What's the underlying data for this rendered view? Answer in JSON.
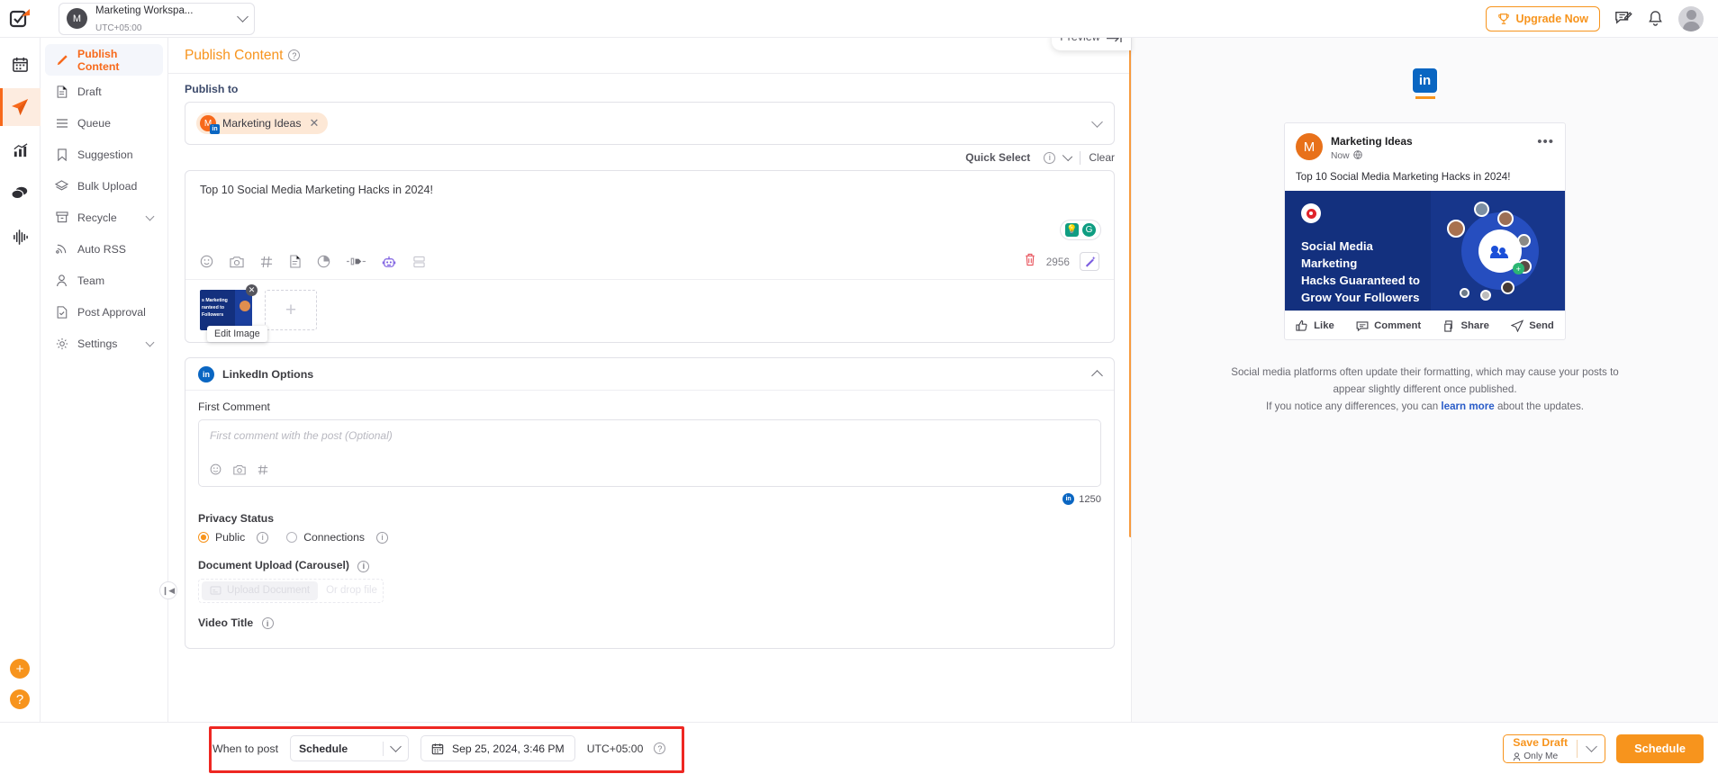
{
  "topbar": {
    "workspace_name": "Marketing Workspa...",
    "workspace_tz": "UTC+05:00",
    "workspace_initial": "M",
    "upgrade_label": "Upgrade Now"
  },
  "sidebar": {
    "items": [
      {
        "label": "Publish Content",
        "icon": "pencil-icon",
        "active": true
      },
      {
        "label": "Draft",
        "icon": "document-icon"
      },
      {
        "label": "Queue",
        "icon": "list-icon"
      },
      {
        "label": "Suggestion",
        "icon": "bookmark-icon"
      },
      {
        "label": "Bulk Upload",
        "icon": "layers-icon"
      },
      {
        "label": "Recycle",
        "icon": "archive-icon",
        "caret": true
      },
      {
        "label": "Auto RSS",
        "icon": "rss-icon"
      },
      {
        "label": "Team",
        "icon": "user-icon"
      },
      {
        "label": "Post Approval",
        "icon": "approval-icon"
      },
      {
        "label": "Settings",
        "icon": "gear-icon",
        "caret": true
      }
    ]
  },
  "main": {
    "title": "Publish Content",
    "preview_label": "Preview",
    "publish_to_label": "Publish to",
    "account_chip": {
      "name": "Marketing Ideas",
      "initial": "M",
      "network": "in"
    },
    "quick_select_label": "Quick Select",
    "clear_label": "Clear",
    "composer_text": "Top 10 Social Media Marketing Hacks in 2024!",
    "char_count": "2956",
    "edit_image_label": "Edit Image",
    "thumb_text": "s Marketing\nranteed to\nFollowers",
    "toolbar_icons": [
      "emoji-icon",
      "camera-icon",
      "hashtag-icon",
      "document-icon",
      "pie-chart-icon",
      "plug-icon",
      "robot-icon",
      "grid-icon"
    ]
  },
  "linkedin_options": {
    "title": "LinkedIn Options",
    "first_comment_label": "First Comment",
    "first_comment_placeholder": "First comment with the post (Optional)",
    "comment_char_limit": "1250",
    "privacy_label": "Privacy Status",
    "privacy_options": [
      {
        "label": "Public",
        "selected": true
      },
      {
        "label": "Connections",
        "selected": false
      }
    ],
    "document_upload_label": "Document Upload (Carousel)",
    "upload_button_label": "Upload Document",
    "drop_text": "Or drop file",
    "video_title_label": "Video Title"
  },
  "preview": {
    "network": "in",
    "post": {
      "author": "Marketing Ideas",
      "author_initial": "M",
      "time": "Now",
      "text": "Top 10 Social Media Marketing Hacks in 2024!",
      "image_title": "Social Media Marketing\nHacks Guaranteed to\nGrow Your Followers",
      "actions": [
        {
          "label": "Like",
          "icon": "thumbs-up-icon"
        },
        {
          "label": "Comment",
          "icon": "comment-icon"
        },
        {
          "label": "Share",
          "icon": "share-icon"
        },
        {
          "label": "Send",
          "icon": "send-icon"
        }
      ]
    },
    "disclaimer_line1": "Social media platforms often update their formatting, which may cause your posts",
    "disclaimer_line2": "to appear slightly different once published.",
    "disclaimer_line3_pre": "If you notice any differences, you can ",
    "disclaimer_link": "learn more",
    "disclaimer_line3_post": " about the updates."
  },
  "bottombar": {
    "when_label": "When to post",
    "schedule_mode": "Schedule",
    "datetime": "Sep 25, 2024, 3:46 PM",
    "timezone": "UTC+05:00",
    "save_draft_label": "Save Draft",
    "save_draft_sub": "Only Me",
    "schedule_label": "Schedule"
  },
  "colors": {
    "accent": "#f7941d",
    "accent_strong": "#f7691b",
    "linkedin": "#0a66c2",
    "highlight_box": "#ee2722"
  }
}
